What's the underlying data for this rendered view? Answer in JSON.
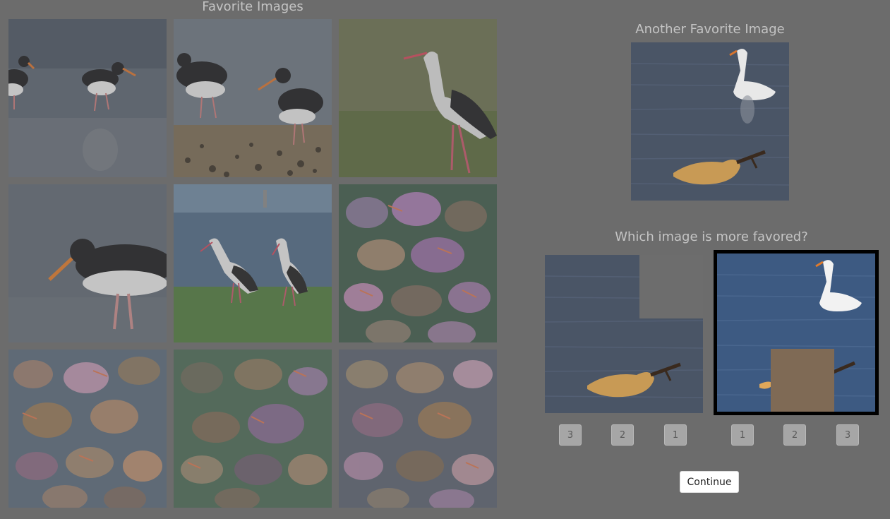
{
  "favorites": {
    "title": "Favorite Images",
    "tiles": [
      {
        "subject": "oystercatchers on shore"
      },
      {
        "subject": "oystercatchers on pebbles"
      },
      {
        "subject": "white stork in grass"
      },
      {
        "subject": "oystercatcher close-up"
      },
      {
        "subject": "two storks on grass"
      },
      {
        "subject": "generated bird pattern"
      },
      {
        "subject": "generated bird pattern"
      },
      {
        "subject": "generated bird pattern"
      },
      {
        "subject": "generated bird pattern"
      }
    ]
  },
  "another": {
    "title": "Another Favorite Image",
    "subject": "swan and retriever in water"
  },
  "comparison": {
    "title": "Which image is more favored?",
    "left_buttons": [
      "3",
      "2",
      "1"
    ],
    "right_buttons": [
      "1",
      "2",
      "3"
    ],
    "selected": "right"
  },
  "continue_label": "Continue",
  "colors": {
    "background": "#6c6c6c",
    "title_text": "#c4c4c4",
    "water": "#4a5a70",
    "selected_border": "#000000",
    "left_patch": "#6d6d6d",
    "right_patch": "#7f6a55"
  }
}
